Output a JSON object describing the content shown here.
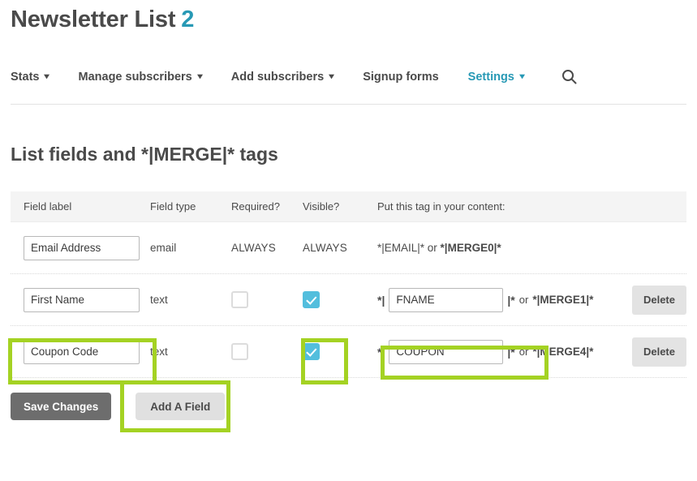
{
  "header": {
    "title": "Newsletter List",
    "count": "2"
  },
  "nav": {
    "items": [
      {
        "label": "Stats",
        "caret": "chevron-down-icon",
        "has_caret": true,
        "active": false
      },
      {
        "label": "Manage subscribers",
        "caret": "chevron-down-icon",
        "has_caret": true,
        "active": false
      },
      {
        "label": "Add subscribers",
        "caret": "chevron-down-icon",
        "has_caret": true,
        "active": false
      },
      {
        "label": "Signup forms",
        "has_caret": false,
        "active": false
      },
      {
        "label": "Settings",
        "caret": "chevron-down-icon",
        "has_caret": true,
        "active": true
      }
    ],
    "search_icon": "search-icon"
  },
  "section": {
    "title": "List fields and *|MERGE|* tags"
  },
  "table": {
    "headers": {
      "field_label": "Field label",
      "field_type": "Field type",
      "required": "Required?",
      "visible": "Visible?",
      "tag": "Put this tag in your content:"
    },
    "rows": [
      {
        "label_value": "Email Address",
        "type": "email",
        "required_text": "ALWAYS",
        "visible_text": "ALWAYS",
        "tag_static": "*|EMAIL|* or *|MERGE0|*",
        "tag_static_plain": "*|EMAIL|* or ",
        "tag_static_bold": "*|MERGE0|*",
        "has_delete": false,
        "editable_tag": false
      },
      {
        "label_value": "First Name",
        "type": "text",
        "required_checked": false,
        "visible_checked": true,
        "tag_prefix": "*|",
        "tag_value": "FNAME",
        "tag_suffix": "|*",
        "tag_or": "or",
        "tag_alt": "*|MERGE1|*",
        "delete_label": "Delete",
        "has_delete": true,
        "editable_tag": true
      },
      {
        "label_value": "Coupon Code",
        "type": "text",
        "required_checked": false,
        "visible_checked": true,
        "tag_prefix": "*|",
        "tag_value": "COUPON",
        "tag_suffix": "|*",
        "tag_or": "or",
        "tag_alt": "*|MERGE4|*",
        "delete_label": "Delete",
        "has_delete": true,
        "editable_tag": true
      }
    ]
  },
  "footer": {
    "save_label": "Save Changes",
    "add_field_label": "Add A Field"
  },
  "colors": {
    "accent_teal": "#2799b5",
    "checkbox_blue": "#53bedd",
    "highlight_green": "#a4d223",
    "save_button_gray": "#6d6d6d",
    "add_button_gray": "#e0e0e0",
    "header_row_gray": "#f4f4f4",
    "text_gray": "#4a4a4a"
  }
}
